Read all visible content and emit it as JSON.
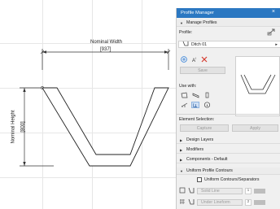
{
  "drawing": {
    "width_label": "Nominal Width",
    "width_value": "[937]",
    "height_label": "Nominal Height",
    "height_value": "[800]"
  },
  "panel": {
    "title": "Profile Manager",
    "close_glyph": "×",
    "manage_profiles": "Manage Profiles",
    "profile_label": "Profile:",
    "profile_name": "Ditch 01",
    "save_label": "Save",
    "use_with_label": "Use with:",
    "element_selection_label": "Element Selection:",
    "capture_label": "Capture",
    "apply_label": "Apply",
    "sections": [
      {
        "label": "Design Layers",
        "expanded": false
      },
      {
        "label": "Modifiers",
        "expanded": false
      },
      {
        "label": "Components - Default",
        "expanded": false
      },
      {
        "label": "Uniform Profile Contours",
        "expanded": true
      }
    ],
    "uniform_checkbox_label": "Uniform Contours/Separators",
    "line_row_1": {
      "dropdown": "Solid Line",
      "value": "1"
    },
    "line_row_2": {
      "dropdown": "Under Lineform",
      "value": "2"
    }
  },
  "colors": {
    "title_bar": "#2b78c2",
    "accent_red": "#d63a2f",
    "accent_blue": "#2f7ed8"
  }
}
